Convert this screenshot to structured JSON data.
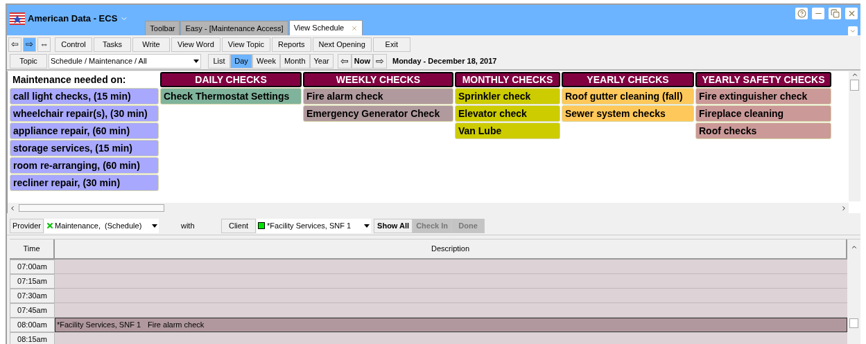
{
  "app": {
    "title": "American Data - ECS"
  },
  "tabs": [
    {
      "label": "Toolbar",
      "selected": false
    },
    {
      "label": "Easy - [Maintenance Access]",
      "selected": false
    },
    {
      "label": "View Schedule",
      "selected": true
    }
  ],
  "nav_buttons": [
    {
      "label": "⇦",
      "selected": false
    },
    {
      "label": "⇨",
      "selected": true
    },
    {
      "label": "⇔",
      "selected": false
    }
  ],
  "toolbar": [
    "Control",
    "Tasks",
    "Write",
    "View Word",
    "View Topic",
    "Reports",
    "Next Opening",
    "Exit"
  ],
  "topic": {
    "label": "Topic",
    "value": "Schedule / Maintenance / All"
  },
  "views": [
    {
      "label": "List",
      "selected": false
    },
    {
      "label": "Day",
      "selected": true
    },
    {
      "label": "Week",
      "selected": false
    },
    {
      "label": "Month",
      "selected": false
    },
    {
      "label": "Year",
      "selected": false
    }
  ],
  "date_nav": {
    "prev": "⇦",
    "now": "Now",
    "next": "⇨",
    "date": "Monday - December 18, 2017"
  },
  "board": {
    "heading": "Maintenance needed on:",
    "items": [
      {
        "label": "call light checks, (15 min)",
        "color": "#a8a8ff"
      },
      {
        "label": "wheelchair repair(s), (30 min)",
        "color": "#a8a8ff"
      },
      {
        "label": "appliance repair, (60 min)",
        "color": "#a8a8ff"
      },
      {
        "label": "storage services, (15 min)",
        "color": "#a8a8ff"
      },
      {
        "label": "room re-arranging, (60 min)",
        "color": "#a8a8ff"
      },
      {
        "label": "recliner repair, (30 min)",
        "color": "#a8a8ff"
      }
    ],
    "columns": [
      {
        "title": "DAILY CHECKS",
        "items": [
          {
            "label": "Check Thermostat Settings",
            "color": "#7fb39b"
          }
        ]
      },
      {
        "title": "WEEKLY CHECKS",
        "items": [
          {
            "label": "Fire alarm check",
            "color": "#b09a9e"
          },
          {
            "label": "Emergency Generator Check",
            "color": "#b09a9e"
          }
        ]
      },
      {
        "title": "MONTHLY CHECKS",
        "items": [
          {
            "label": "Sprinkler check",
            "color": "#cccc00"
          },
          {
            "label": "Elevator check",
            "color": "#cccc00"
          },
          {
            "label": "Van Lube",
            "color": "#cccc00"
          }
        ]
      },
      {
        "title": "YEARLY CHECKS",
        "items": [
          {
            "label": "Roof gutter cleaning (fall)",
            "color": "#ffc85a"
          },
          {
            "label": "Sewer system checks",
            "color": "#ffc85a"
          }
        ]
      },
      {
        "title": "YEARLY SAFETY CHECKS",
        "items": [
          {
            "label": "Fire extinguisher check",
            "color": "#cc9999"
          },
          {
            "label": "Fireplace cleaning",
            "color": "#cc9999"
          },
          {
            "label": "Roof checks",
            "color": "#cc9999"
          }
        ]
      }
    ]
  },
  "filters": {
    "provider_label": "Provider",
    "provider": "Maintenance,  (Schedule)",
    "with": "with",
    "client_label": "Client",
    "client": "*Facility Services, SNF 1",
    "buttons": [
      {
        "label": "Show All",
        "selected": true
      },
      {
        "label": "Check In",
        "selected": false
      },
      {
        "label": "Done",
        "selected": false
      }
    ]
  },
  "schedule": {
    "columns": [
      "Time",
      "Description"
    ],
    "rows": [
      {
        "time": "07:00am",
        "booked": false
      },
      {
        "time": "07:15am",
        "booked": false
      },
      {
        "time": "07:30am",
        "booked": false
      },
      {
        "time": "07:45am",
        "booked": false
      },
      {
        "time": "08:00am",
        "booked": true,
        "client": "*Facility Services, SNF 1",
        "task": "Fire alarm check"
      },
      {
        "time": "08:15am",
        "booked": false
      }
    ]
  }
}
